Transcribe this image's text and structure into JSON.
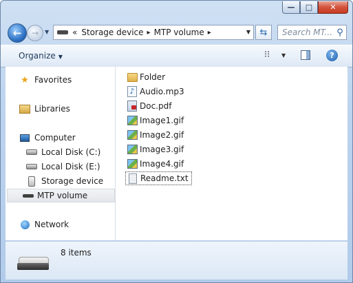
{
  "window": {
    "caption_buttons": {
      "minimize": "—",
      "maximize": "□",
      "close": "✕"
    }
  },
  "nav": {
    "back_icon": "left-arrow",
    "forward_icon": "right-arrow",
    "address": {
      "overflow_chevron": "«",
      "crumbs": [
        "Storage device",
        "MTP volume"
      ],
      "separator": "▸"
    },
    "search_placeholder": "Search MT..."
  },
  "toolbar": {
    "organize_label": "Organize"
  },
  "sidebar": {
    "favorites": "Favorites",
    "libraries": "Libraries",
    "computer": "Computer",
    "local_c": "Local Disk (C:)",
    "local_e": "Local Disk (E:)",
    "storage_device": "Storage device",
    "mtp_volume": "MTP volume",
    "network": "Network"
  },
  "files": [
    {
      "name": "Folder",
      "type": "folder"
    },
    {
      "name": "Audio.mp3",
      "type": "audio"
    },
    {
      "name": "Doc.pdf",
      "type": "pdf"
    },
    {
      "name": "Image1.gif",
      "type": "image"
    },
    {
      "name": "Image2.gif",
      "type": "image"
    },
    {
      "name": "Image3.gif",
      "type": "image"
    },
    {
      "name": "Image4.gif",
      "type": "image"
    },
    {
      "name": "Readme.txt",
      "type": "text"
    }
  ],
  "status": {
    "item_count": "8 items"
  }
}
